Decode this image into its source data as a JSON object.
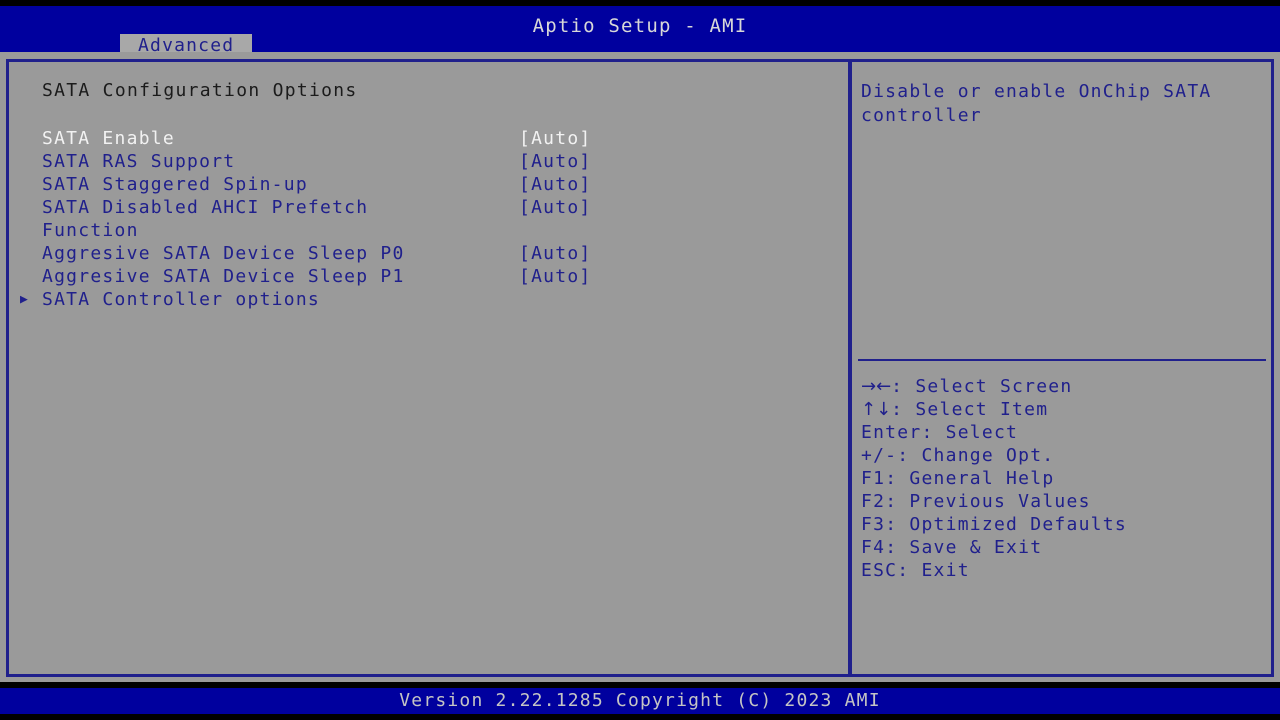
{
  "colors": {
    "header_blue": "#00009e",
    "panel_gray": "#9a9a9a",
    "border_blue": "#20208c",
    "text_blue": "#20208c",
    "text_selected": "#f2f2f2",
    "title_black": "#1b1b1b",
    "footer_text": "#c4c4c4"
  },
  "header": {
    "title": "Aptio Setup - AMI",
    "tabs": [
      {
        "label": "Advanced",
        "active": true
      }
    ]
  },
  "main": {
    "section_title": "SATA Configuration Options",
    "options": [
      {
        "label": "SATA Enable",
        "value": "[Auto]",
        "selected": true,
        "submenu": false,
        "arrow": ""
      },
      {
        "label": "SATA RAS Support",
        "value": "[Auto]",
        "selected": false,
        "submenu": false,
        "arrow": ""
      },
      {
        "label": "SATA Staggered Spin-up",
        "value": "[Auto]",
        "selected": false,
        "submenu": false,
        "arrow": ""
      },
      {
        "label": "SATA Disabled AHCI Prefetch",
        "value": "[Auto]",
        "selected": false,
        "submenu": false,
        "arrow": ""
      },
      {
        "label": "Function",
        "value": "",
        "selected": false,
        "submenu": false,
        "arrow": ""
      },
      {
        "label": "Aggresive SATA Device Sleep P0",
        "value": "[Auto]",
        "selected": false,
        "submenu": false,
        "arrow": ""
      },
      {
        "label": "Aggresive SATA Device Sleep P1",
        "value": "[Auto]",
        "selected": false,
        "submenu": false,
        "arrow": ""
      },
      {
        "label": "SATA Controller options",
        "value": "",
        "selected": false,
        "submenu": true,
        "arrow": "▶"
      }
    ]
  },
  "help": {
    "text": "Disable or enable OnChip SATA controller",
    "legend": [
      {
        "key": "→←",
        "text": ": Select Screen",
        "key_is_glyph": true
      },
      {
        "key": "↑↓",
        "text": ": Select Item",
        "key_is_glyph": true
      },
      {
        "key": "Enter",
        "text": ": Select",
        "key_is_glyph": false
      },
      {
        "key": "+/-",
        "text": ": Change Opt.",
        "key_is_glyph": false
      },
      {
        "key": "F1",
        "text": ": General Help",
        "key_is_glyph": false
      },
      {
        "key": "F2",
        "text": ": Previous Values",
        "key_is_glyph": false
      },
      {
        "key": "F3",
        "text": ": Optimized Defaults",
        "key_is_glyph": false
      },
      {
        "key": "F4",
        "text": ": Save & Exit",
        "key_is_glyph": false
      },
      {
        "key": "ESC",
        "text": ": Exit",
        "key_is_glyph": false
      }
    ]
  },
  "footer": {
    "version_text": "Version 2.22.1285 Copyright (C) 2023 AMI"
  }
}
